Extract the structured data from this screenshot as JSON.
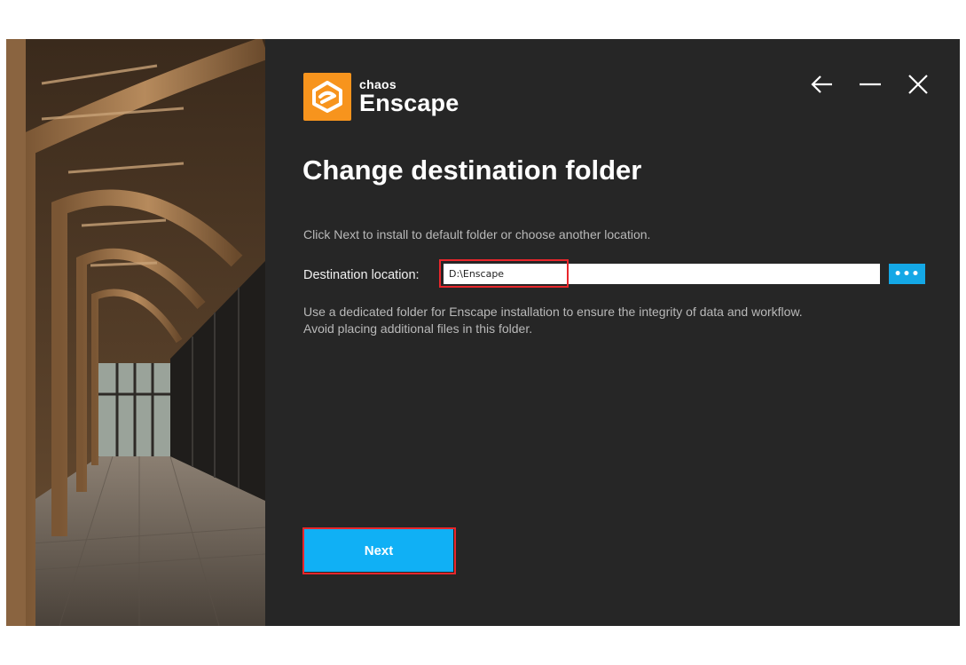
{
  "brand": {
    "company": "chaos",
    "product": "Enscape",
    "accent_color": "#f7941d",
    "logo_icon": "enscape-logo-icon"
  },
  "window_controls": {
    "back_icon": "arrow-left-icon",
    "minimize_icon": "minimize-icon",
    "close_icon": "close-icon"
  },
  "page": {
    "title": "Change destination folder",
    "intro": "Click Next to install to default folder or choose another location."
  },
  "destination": {
    "label": "Destination location:",
    "value": "D:\\Enscape",
    "browse_label": "•••"
  },
  "note": {
    "line1": "Use a dedicated folder for Enscape installation to ensure the integrity of data and workflow.",
    "line2": "Avoid placing additional files in this folder."
  },
  "actions": {
    "next_label": "Next",
    "button_color": "#10b0f5",
    "highlight_color": "#e8262b"
  }
}
